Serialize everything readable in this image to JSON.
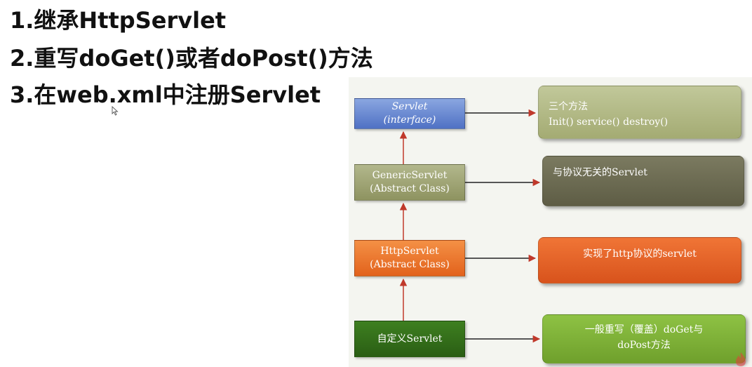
{
  "headings": [
    "1.继承HttpServlet",
    "2.重写doGet()或者doPost()方法",
    "3.在web.xml中注册Servlet"
  ],
  "nodes": {
    "servlet": [
      "Servlet",
      "(interface)"
    ],
    "generic": [
      "GenericServlet",
      "(Abstract  Class)"
    ],
    "http": [
      "HttpServlet",
      "(Abstract  Class)"
    ],
    "custom": [
      "自定义Servlet"
    ]
  },
  "descriptions": {
    "servlet": [
      "三个方法",
      "Init() service() destroy()"
    ],
    "generic": [
      "与协议无关的Servlet"
    ],
    "http": [
      "实现了http协议的servlet"
    ],
    "custom": [
      "一般重写（覆盖）doGet与",
      "doPost方法"
    ]
  },
  "colors": {
    "servlet": "#5a7cc9",
    "generic": "#9fa46f",
    "http": "#e8691f",
    "custom": "#2f6a17",
    "desc_generic": "#67664d",
    "desc_custom": "#7cb035",
    "arrow": "#c0392b"
  },
  "icons": {
    "cursor": "mouse-pointer-icon",
    "watermark": "imooc-watermark-logo"
  }
}
